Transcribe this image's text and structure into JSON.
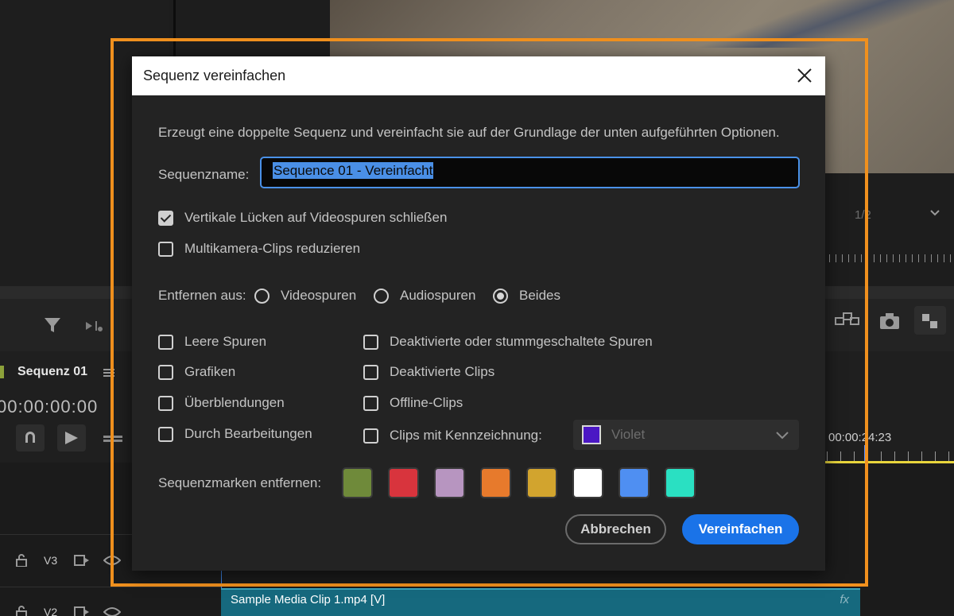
{
  "background": {
    "sequence_title": "Sequenz 01",
    "timecode": "00:00:00:00",
    "timecode_right": "00:00:24:23",
    "zoom_value": "1/2",
    "track_v3": "V3",
    "track_v2": "V2",
    "clip_label": "Sample Media Clip 1.mp4 [V]",
    "clip_fx": "fx"
  },
  "dialog": {
    "title": "Sequenz vereinfachen",
    "description": "Erzeugt eine doppelte Sequenz und vereinfacht sie auf der Grundlage der unten aufgeführten Optionen.",
    "name_label": "Sequenzname:",
    "name_value": "Sequence 01 - Vereinfacht",
    "options": {
      "close_gaps": {
        "label": "Vertikale Lücken auf Videospuren schließen",
        "checked": true
      },
      "reduce_multicam": {
        "label": "Multikamera-Clips reduzieren",
        "checked": false
      }
    },
    "remove_from": {
      "label": "Entfernen aus:",
      "choices": [
        {
          "label": "Videospuren",
          "selected": false
        },
        {
          "label": "Audiospuren",
          "selected": false
        },
        {
          "label": "Beides",
          "selected": true
        }
      ]
    },
    "remove_items_left": [
      {
        "label": "Leere Spuren",
        "checked": false
      },
      {
        "label": "Grafiken",
        "checked": false
      },
      {
        "label": "Überblendungen",
        "checked": false
      },
      {
        "label": "Durch Bearbeitungen",
        "checked": false
      }
    ],
    "remove_items_right": [
      {
        "label": "Deaktivierte oder stummgeschaltete Spuren",
        "checked": false
      },
      {
        "label": "Deaktivierte Clips",
        "checked": false
      },
      {
        "label": "Offline-Clips",
        "checked": false
      },
      {
        "label": "Clips mit Kennzeichnung:",
        "checked": false
      }
    ],
    "label_dropdown": {
      "value": "Violet",
      "color": "#4b17c4"
    },
    "markers_label": "Sequenzmarken entfernen:",
    "marker_colors": [
      "#6f8a3a",
      "#d8343d",
      "#b795c0",
      "#e77a2c",
      "#d2a42e",
      "#ffffff",
      "#4f8ff2",
      "#2ae0c2"
    ],
    "cancel_label": "Abbrechen",
    "ok_label": "Vereinfachen"
  },
  "colors": {
    "highlight": "#f0901e",
    "accent": "#1a73e8"
  }
}
